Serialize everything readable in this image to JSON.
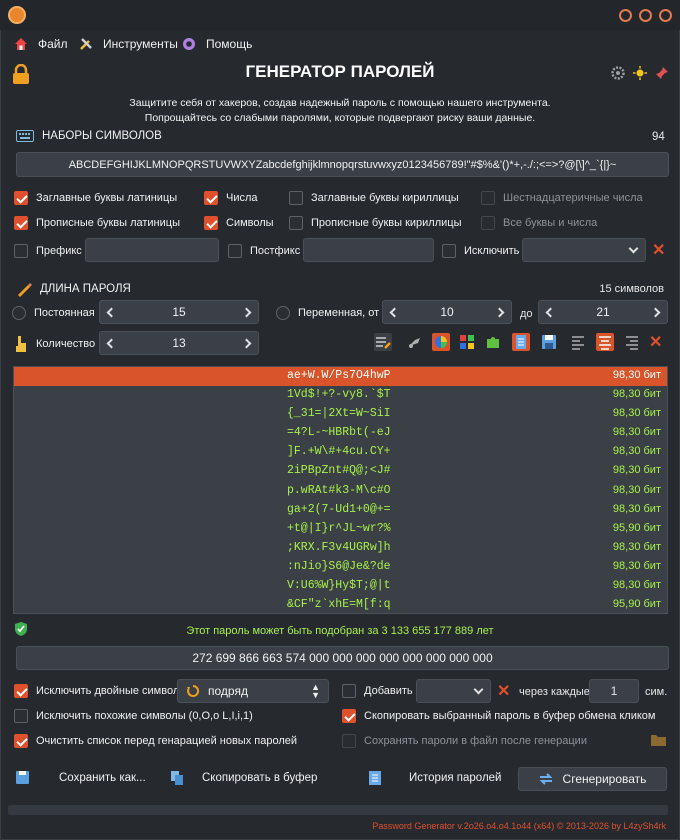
{
  "menu": {
    "file": "Файл",
    "tools": "Инструменты",
    "help": "Помощь"
  },
  "header": {
    "title": "ГЕНЕРАТОР ПАРОЛЕЙ",
    "subtitle_line1": "Защитите себя от хакеров, создав надежный пароль с помощью нашего инструмента.",
    "subtitle_line2": "Попрощайтесь со слабыми паролями, которые подвергают риску ваши данные."
  },
  "charsets": {
    "label": "НАБОРЫ СИМВОЛОВ",
    "count": "94",
    "value": "ABCDEFGHIJKLMNOPQRSTUVWXYZabcdefghijklmnopqrstuvwxyz0123456789!\"#$%&'()*+,-./:;<=>?@[\\]^_`{|}~"
  },
  "options": {
    "upper_latin": "Заглавные буквы латиницы",
    "digits": "Числа",
    "upper_cyr": "Заглавные буквы кириллицы",
    "hex": "Шестнадцатеричные числа",
    "lower_latin": "Прописные буквы латиницы",
    "symbols": "Символы",
    "lower_cyr": "Прописные буквы кириллицы",
    "all_alnum": "Все буквы и числа",
    "prefix": "Префикс",
    "postfix": "Постфикс",
    "exclude": "Исключить"
  },
  "length": {
    "label": "ДЛИНА ПАРОЛЯ",
    "summary": "15 символов",
    "constant": "Постоянная",
    "constant_value": "15",
    "variable": "Переменная, от",
    "from_value": "10",
    "to_label": "до",
    "to_value": "21",
    "quantity": "Количество",
    "quantity_value": "13"
  },
  "passwords": [
    {
      "pw": "ae+W.W/Ps7O4hwP",
      "bits": "98,30 бит",
      "selected": true
    },
    {
      "pw": "1Vd$!+?-vy8.`$T",
      "bits": "98,30 бит"
    },
    {
      "pw": "{_31=|2Xt=W~SiI",
      "bits": "98,30 бит"
    },
    {
      "pw": "=4?L-~HBRbt(-eJ",
      "bits": "98,30 бит"
    },
    {
      "pw": "]F.+W\\#+4cu.CY+",
      "bits": "98,30 бит"
    },
    {
      "pw": "2iPBpZnt#Q@;<J#",
      "bits": "98,30 бит"
    },
    {
      "pw": "p.wRAt#k3-M\\c#O",
      "bits": "98,30 бит"
    },
    {
      "pw": "ga+2(7-Ud1+0@+=",
      "bits": "98,30 бит"
    },
    {
      "pw": "+t@|I}r^JL~wr?%",
      "bits": "95,90 бит"
    },
    {
      "pw": ";KRX.F3v4UGRw]h",
      "bits": "98,30 бит"
    },
    {
      "pw": ":nJio}S6@Je&?de",
      "bits": "98,30 бит"
    },
    {
      "pw": "V:U6%W}Hy$T;@|t",
      "bits": "98,30 бит"
    },
    {
      "pw": "&CF\"z`xhE=M[f:q",
      "bits": "95,90 бит"
    }
  ],
  "crack_text": "Этот пароль может быть подобран за 3 133 655 177 889 лет",
  "combinations": "272 699 866 663 574 000 000 000 000 000 000 000 000",
  "bottom_options": {
    "exclude_double": "Исключить двойные символы",
    "double_mode": "подряд",
    "add": "Добавить",
    "every_label": "через каждые",
    "every_value": "1",
    "every_unit": "сим.",
    "exclude_similar": "Исключить похожие символы (0,O,o L,I,i,1)",
    "copy_on_click": "Скопировать выбранный пароль в буфер обмена кликом",
    "clear_list": "Очистить список перед генарацией новых паролей",
    "save_to_file": "Сохранять пароли в файл  после генерации"
  },
  "actions": {
    "save_as": "Сохранить как...",
    "copy": "Скопировать в буфер",
    "history": "История паролей",
    "generate": "Сгенерировать"
  },
  "footer": "Password Generator v.2o26.o4.o4.1o44 (x64) © 2013-2026 by L4zySh4rk",
  "colors": {
    "accent": "#e0502c",
    "password_text": "#a6f04a",
    "background": "#262a2f"
  }
}
